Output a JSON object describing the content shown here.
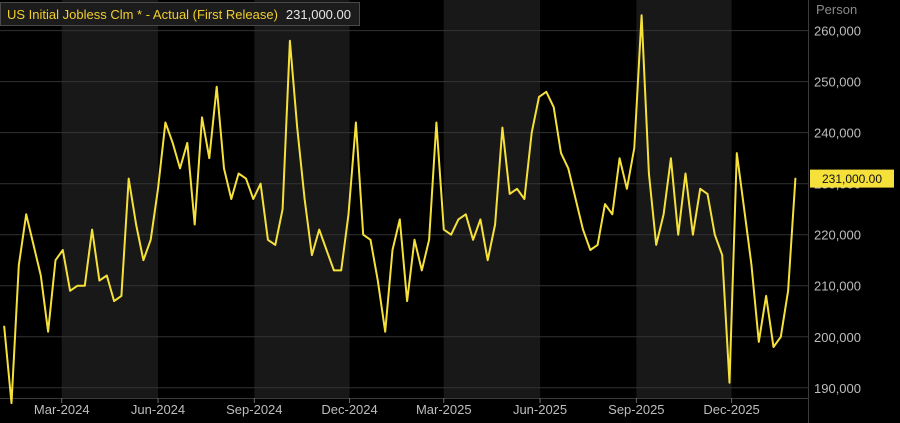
{
  "chart_data": {
    "type": "line",
    "series": [
      {
        "name": "US Initial Jobless Clm * - Actual (First Release)",
        "color": "#f5e13a",
        "last_value_label": "231,000.00",
        "points": [
          [
            "2024-01-06",
            202000
          ],
          [
            "2024-01-13",
            187000
          ],
          [
            "2024-01-20",
            214000
          ],
          [
            "2024-01-27",
            224000
          ],
          [
            "2024-02-03",
            218000
          ],
          [
            "2024-02-10",
            212000
          ],
          [
            "2024-02-17",
            201000
          ],
          [
            "2024-02-24",
            215000
          ],
          [
            "2024-03-02",
            217000
          ],
          [
            "2024-03-09",
            209000
          ],
          [
            "2024-03-16",
            210000
          ],
          [
            "2024-03-23",
            210000
          ],
          [
            "2024-03-30",
            221000
          ],
          [
            "2024-04-06",
            211000
          ],
          [
            "2024-04-13",
            212000
          ],
          [
            "2024-04-20",
            207000
          ],
          [
            "2024-04-27",
            208000
          ],
          [
            "2024-05-04",
            231000
          ],
          [
            "2024-05-11",
            222000
          ],
          [
            "2024-05-18",
            215000
          ],
          [
            "2024-05-25",
            219000
          ],
          [
            "2024-06-01",
            229000
          ],
          [
            "2024-06-08",
            242000
          ],
          [
            "2024-06-15",
            238000
          ],
          [
            "2024-06-22",
            233000
          ],
          [
            "2024-06-29",
            238000
          ],
          [
            "2024-07-06",
            222000
          ],
          [
            "2024-07-13",
            243000
          ],
          [
            "2024-07-20",
            235000
          ],
          [
            "2024-07-27",
            249000
          ],
          [
            "2024-08-03",
            233000
          ],
          [
            "2024-08-10",
            227000
          ],
          [
            "2024-08-17",
            232000
          ],
          [
            "2024-08-24",
            231000
          ],
          [
            "2024-08-31",
            227000
          ],
          [
            "2024-09-07",
            230000
          ],
          [
            "2024-09-14",
            219000
          ],
          [
            "2024-09-21",
            218000
          ],
          [
            "2024-09-28",
            225000
          ],
          [
            "2024-10-05",
            258000
          ],
          [
            "2024-10-12",
            241000
          ],
          [
            "2024-10-19",
            227000
          ],
          [
            "2024-10-26",
            216000
          ],
          [
            "2024-11-02",
            221000
          ],
          [
            "2024-11-09",
            217000
          ],
          [
            "2024-11-16",
            213000
          ],
          [
            "2024-11-23",
            213000
          ],
          [
            "2024-11-30",
            224000
          ],
          [
            "2024-12-07",
            242000
          ],
          [
            "2024-12-14",
            220000
          ],
          [
            "2024-12-21",
            219000
          ],
          [
            "2024-12-28",
            211000
          ],
          [
            "2025-01-04",
            201000
          ],
          [
            "2025-01-11",
            217000
          ],
          [
            "2025-01-18",
            223000
          ],
          [
            "2025-01-25",
            207000
          ],
          [
            "2025-02-01",
            219000
          ],
          [
            "2025-02-08",
            213000
          ],
          [
            "2025-02-15",
            219000
          ],
          [
            "2025-02-22",
            242000
          ],
          [
            "2025-03-01",
            221000
          ],
          [
            "2025-03-08",
            220000
          ],
          [
            "2025-03-15",
            223000
          ],
          [
            "2025-03-22",
            224000
          ],
          [
            "2025-03-29",
            219000
          ],
          [
            "2025-04-05",
            223000
          ],
          [
            "2025-04-12",
            215000
          ],
          [
            "2025-04-19",
            222000
          ],
          [
            "2025-04-26",
            241000
          ],
          [
            "2025-05-03",
            228000
          ],
          [
            "2025-05-10",
            229000
          ],
          [
            "2025-05-17",
            227000
          ],
          [
            "2025-05-24",
            240000
          ],
          [
            "2025-05-31",
            247000
          ],
          [
            "2025-06-07",
            248000
          ],
          [
            "2025-06-14",
            245000
          ],
          [
            "2025-06-21",
            236000
          ],
          [
            "2025-06-28",
            233000
          ],
          [
            "2025-07-05",
            227000
          ],
          [
            "2025-07-12",
            221000
          ],
          [
            "2025-07-19",
            217000
          ],
          [
            "2025-07-26",
            218000
          ],
          [
            "2025-08-02",
            226000
          ],
          [
            "2025-08-09",
            224000
          ],
          [
            "2025-08-16",
            235000
          ],
          [
            "2025-08-23",
            229000
          ],
          [
            "2025-08-30",
            237000
          ],
          [
            "2025-09-06",
            263000
          ],
          [
            "2025-09-13",
            232000
          ],
          [
            "2025-09-20",
            218000
          ],
          [
            "2025-09-27",
            224000
          ],
          [
            "2025-10-04",
            235000
          ],
          [
            "2025-10-11",
            220000
          ],
          [
            "2025-10-18",
            232000
          ],
          [
            "2025-10-25",
            220000
          ],
          [
            "2025-11-01",
            229000
          ],
          [
            "2025-11-08",
            228000
          ],
          [
            "2025-11-15",
            220000
          ],
          [
            "2025-11-22",
            216000
          ],
          [
            "2025-11-29",
            191000
          ],
          [
            "2025-12-06",
            236000
          ],
          [
            "2025-12-13",
            225000
          ],
          [
            "2025-12-20",
            214000
          ],
          [
            "2025-12-27",
            199000
          ],
          [
            "2026-01-03",
            208000
          ],
          [
            "2026-01-10",
            198000
          ],
          [
            "2026-01-17",
            200000
          ],
          [
            "2026-01-24",
            209000
          ],
          [
            "2026-01-31",
            231000
          ]
        ]
      }
    ],
    "legend": {
      "name": "US Initial Jobless Clm * - Actual (First Release)",
      "value": "231,000.00",
      "placement": "top-left"
    },
    "y_unit_label": "Person",
    "ylim": [
      188000,
      266000
    ],
    "yticks": [
      {
        "value": 190000,
        "label": "190,000"
      },
      {
        "value": 200000,
        "label": "200,000"
      },
      {
        "value": 210000,
        "label": "210,000"
      },
      {
        "value": 220000,
        "label": "220,000"
      },
      {
        "value": 230000,
        "label": "230,000"
      },
      {
        "value": 240000,
        "label": "240,000"
      },
      {
        "value": 250000,
        "label": "250,000"
      },
      {
        "value": 260000,
        "label": "260,000"
      }
    ],
    "xlim": [
      "2024-01-02",
      "2026-02-12"
    ],
    "xticks": [
      {
        "value": "2024-03-01",
        "label": "Mar-2024"
      },
      {
        "value": "2024-06-01",
        "label": "Jun-2024"
      },
      {
        "value": "2024-09-01",
        "label": "Sep-2024"
      },
      {
        "value": "2024-12-01",
        "label": "Dec-2024"
      },
      {
        "value": "2025-03-01",
        "label": "Mar-2025"
      },
      {
        "value": "2025-06-01",
        "label": "Jun-2025"
      },
      {
        "value": "2025-09-01",
        "label": "Sep-2025"
      },
      {
        "value": "2025-12-01",
        "label": "Dec-2025"
      }
    ],
    "grid": true,
    "colors": {
      "background": "#000000",
      "alternate_band": "#181818",
      "grid": "#333333",
      "axis_text": "#bdbdbd",
      "legend_text": "#f2cf2c",
      "last_value_bg": "#f5e13a"
    }
  }
}
